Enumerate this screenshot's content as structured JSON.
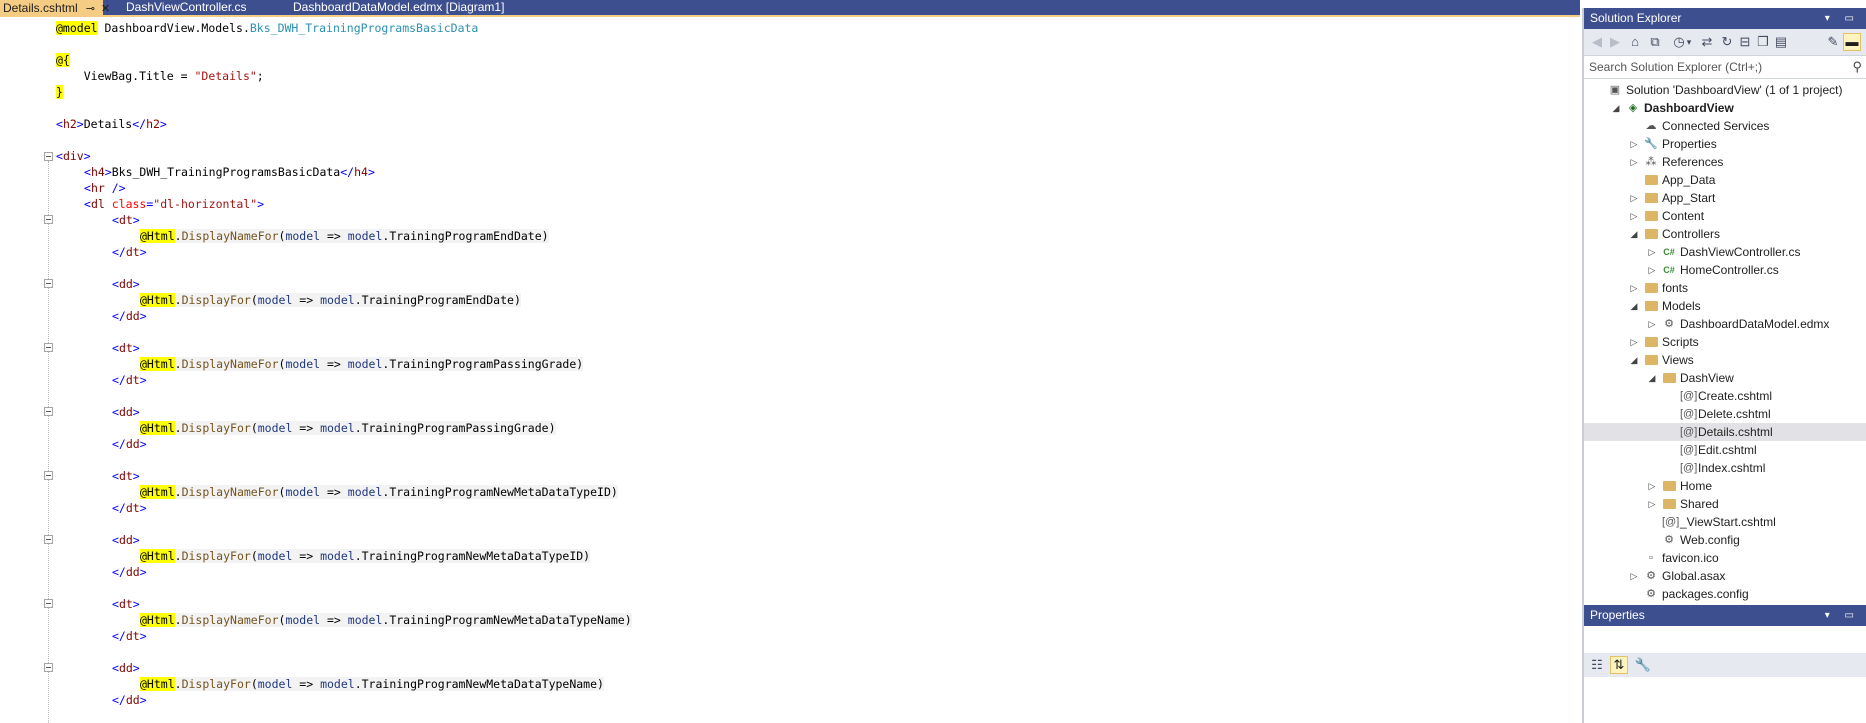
{
  "tabs": [
    {
      "label": "Details.cshtml",
      "active": true,
      "pin_icon": "⊸",
      "close_icon": "✕"
    },
    {
      "label": "DashViewController.cs",
      "active": false
    },
    {
      "label": "DashboardDataModel.edmx [Diagram1]",
      "active": false
    }
  ],
  "code": {
    "l1": {
      "razor": "@model",
      "ns": " DashboardView.Models.",
      "type": "Bks_DWH_TrainingProgramsBasicData"
    },
    "l2": {
      "razor": "@{"
    },
    "l3": {
      "a": "    ViewBag.Title = ",
      "str": "\"Details\"",
      "b": ";"
    },
    "l4": {
      "razor": "}"
    },
    "l5": {
      "open": "<",
      "tag": "h2",
      "close": ">",
      "text": "Details",
      "open2": "</",
      "tag2": "h2",
      "close2": ">"
    },
    "l6": {
      "open": "<",
      "tag": "div",
      "close": ">"
    },
    "l7": {
      "open": "<",
      "tag": "h4",
      "close": ">",
      "text": "Bks_DWH_TrainingProgramsBasicData",
      "open2": "</",
      "tag2": "h4",
      "close2": ">"
    },
    "l8": {
      "open": "<",
      "tag": "hr",
      "close": " />"
    },
    "l9": {
      "open": "<",
      "tag": "dl",
      "attr": " class",
      "eq": "=",
      "str": "\"dl-horizontal\"",
      "close": ">"
    },
    "dt_open": {
      "open": "<",
      "tag": "dt",
      "close": ">"
    },
    "dt_close": {
      "open": "</",
      "tag": "dt",
      "close": ">"
    },
    "dd_open": {
      "open": "<",
      "tag": "dd",
      "close": ">"
    },
    "dd_close": {
      "open": "</",
      "tag": "dd",
      "close": ">"
    },
    "html": "@Html",
    "dot": ".",
    "display_name_for": "DisplayNameFor",
    "display_for": "DisplayFor",
    "paren_open": "(",
    "param": "model",
    "arrow": " => ",
    "param2": "model",
    "props": [
      ".TrainingProgramEndDate)",
      ".TrainingProgramEndDate)",
      ".TrainingProgramPassingGrade)",
      ".TrainingProgramPassingGrade)",
      ".TrainingProgramNewMetaDataTypeID)",
      ".TrainingProgramNewMetaDataTypeID)",
      ".TrainingProgramNewMetaDataTypeName)",
      ".TrainingProgramNewMetaDataTypeName)"
    ]
  },
  "solution_explorer": {
    "title": "Solution Explorer",
    "title_buttons": "▾ ▭",
    "search_placeholder": "Search Solution Explorer (Ctrl+;)",
    "search_icon": "⚲",
    "toolbar": {
      "back": "◀",
      "forward": "▶",
      "home": "⌂",
      "vs": "⧉",
      "history": "◷",
      "history_arrow": "▾",
      "sync": "⇄",
      "refresh": "↻",
      "collapse": "⊟",
      "copy": "❐",
      "preview": "▤",
      "settings": "✎",
      "pin": "▬"
    },
    "tree": [
      {
        "label": "Solution 'DashboardView' (1 of 1 project)",
        "icon": "▣"
      },
      {
        "label": "DashboardView",
        "icon": "◈",
        "arrow": "◢"
      },
      {
        "label": "Connected Services",
        "icon": "☁"
      },
      {
        "label": "Properties",
        "icon": "🔧",
        "arrow": "▷"
      },
      {
        "label": "References",
        "icon": "⁂",
        "arrow": "▷"
      },
      {
        "label": "App_Data"
      },
      {
        "label": "App_Start",
        "arrow": "▷"
      },
      {
        "label": "Content",
        "arrow": "▷"
      },
      {
        "label": "Controllers",
        "arrow": "◢"
      },
      {
        "label": "DashViewController.cs",
        "icon": "C#",
        "arrow": "▷"
      },
      {
        "label": "HomeController.cs",
        "icon": "C#",
        "arrow": "▷"
      },
      {
        "label": "fonts",
        "arrow": "▷"
      },
      {
        "label": "Models",
        "arrow": "◢"
      },
      {
        "label": "DashboardDataModel.edmx",
        "icon": "⚙",
        "arrow": "▷"
      },
      {
        "label": "Scripts",
        "arrow": "▷"
      },
      {
        "label": "Views",
        "arrow": "◢"
      },
      {
        "label": "DashView",
        "arrow": "◢"
      },
      {
        "label": "Create.cshtml",
        "icon": "[@]"
      },
      {
        "label": "Delete.cshtml",
        "icon": "[@]"
      },
      {
        "label": "Details.cshtml",
        "icon": "[@]"
      },
      {
        "label": "Edit.cshtml",
        "icon": "[@]"
      },
      {
        "label": "Index.cshtml",
        "icon": "[@]"
      },
      {
        "label": "Home",
        "arrow": "▷"
      },
      {
        "label": "Shared",
        "arrow": "▷"
      },
      {
        "label": "_ViewStart.cshtml",
        "icon": "[@]"
      },
      {
        "label": "Web.config",
        "icon": "⚙"
      },
      {
        "label": "favicon.ico",
        "icon": "▫"
      },
      {
        "label": "Global.asax",
        "icon": "⚙",
        "arrow": "▷"
      },
      {
        "label": "packages.config",
        "icon": "⚙"
      }
    ]
  },
  "properties": {
    "title": "Properties",
    "title_buttons": "▾ ▭",
    "categorized": "☷",
    "alphabetical": "⇅",
    "property_pages": "🔧"
  }
}
